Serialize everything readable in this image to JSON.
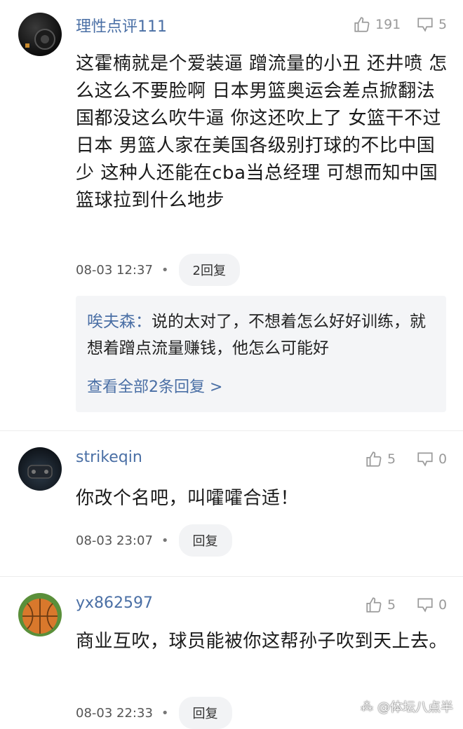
{
  "comments": [
    {
      "username": "理性点评111",
      "likes": "191",
      "dislikes": "5",
      "text": "这霍楠就是个爱装逼 蹭流量的小丑 还井喷 怎么这么不要脸啊 日本男篮奥运会差点掀翻法国都没这么吹牛逼 你这还吹上了 女篮干不过日本 男篮人家在美国各级别打球的不比中国少 这种人还能在cba当总经理 可想而知中国篮球拉到什么地步",
      "time": "08-03 12:37",
      "reply_label": "2回复",
      "reply_preview": {
        "author": "唉夫森：",
        "text": "说的太对了，不想着怎么好好训练，就想着蹭点流量赚钱，他怎么可能好",
        "see_all": "查看全部2条回复 >"
      }
    },
    {
      "username": "strikeqin",
      "likes": "5",
      "dislikes": "0",
      "text": "你改个名吧，叫嚯嚯合适！",
      "time": "08-03 23:07",
      "reply_label": "回复"
    },
    {
      "username": "yx862597",
      "likes": "5",
      "dislikes": "0",
      "text": "商业互吹，球员能被你这帮孙子吹到天上去。",
      "time": "08-03 22:33",
      "reply_label": "回复"
    }
  ],
  "separator": "•",
  "icons": {
    "like": "thumbs-up-icon",
    "dislike": "thumbs-down-icon"
  },
  "watermark": "@体坛八点半",
  "colors": {
    "username": "#4a6fa5",
    "stat": "#9a9a9a",
    "reply_bg": "#f4f5f7"
  }
}
